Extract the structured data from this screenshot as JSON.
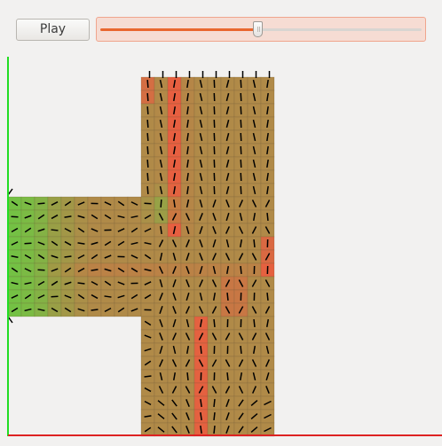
{
  "toolbar": {
    "play_label": "Play",
    "slider_value": 0.49
  },
  "simulation": {
    "grid_left_region": {
      "cols": 10,
      "rows": 9
    },
    "grid_tall_region": {
      "cols": 10,
      "rows": 27
    },
    "colors": {
      "background": "#f2f1f0",
      "y_axis": "#22dd22",
      "x_axis": "#dd2222",
      "cell_base": "#b08a48",
      "cell_hot": "#ec5b3f",
      "cell_cool": "#74c144",
      "vector": "#000000",
      "cell_border": "#6e5a3a"
    }
  }
}
